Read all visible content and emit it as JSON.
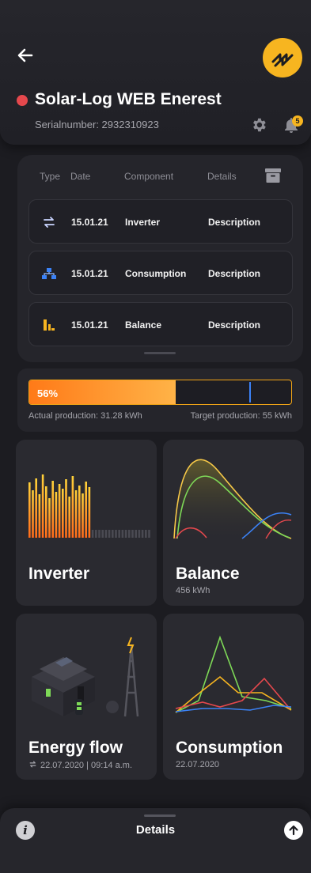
{
  "header": {
    "site_name": "Solar-Log WEB Enerest",
    "serial": "Serialnumber: 2932310923",
    "status_color": "#e5484d",
    "brand_color": "#f7b520",
    "notification_count": "5"
  },
  "events": {
    "columns": {
      "type": "Type",
      "date": "Date",
      "component": "Component",
      "details": "Details"
    },
    "rows": [
      {
        "icon": "swap-arrows-icon",
        "date": "15.01.21",
        "component": "Inverter",
        "details": "Description"
      },
      {
        "icon": "network-icon",
        "date": "15.01.21",
        "component": "Consumption",
        "details": "Description"
      },
      {
        "icon": "bar-chart-icon",
        "date": "15.01.21",
        "component": "Balance",
        "details": "Description"
      }
    ]
  },
  "production": {
    "percent_label": "56%",
    "fill_fraction": 0.56,
    "target_marker_fraction": 0.84,
    "actual": "Actual production: 31.28 kWh",
    "target": "Target production: 55 kWh"
  },
  "tiles": {
    "inverter": {
      "title": "Inverter"
    },
    "balance": {
      "title": "Balance",
      "subtitle": "456 kWh"
    },
    "energy_flow": {
      "title": "Energy flow",
      "subtitle": "22.07.2020 | 09:14 a.m."
    },
    "consumption": {
      "title": "Consumption",
      "subtitle": "22.07.2020"
    }
  },
  "bottom": {
    "details_label": "Details"
  }
}
